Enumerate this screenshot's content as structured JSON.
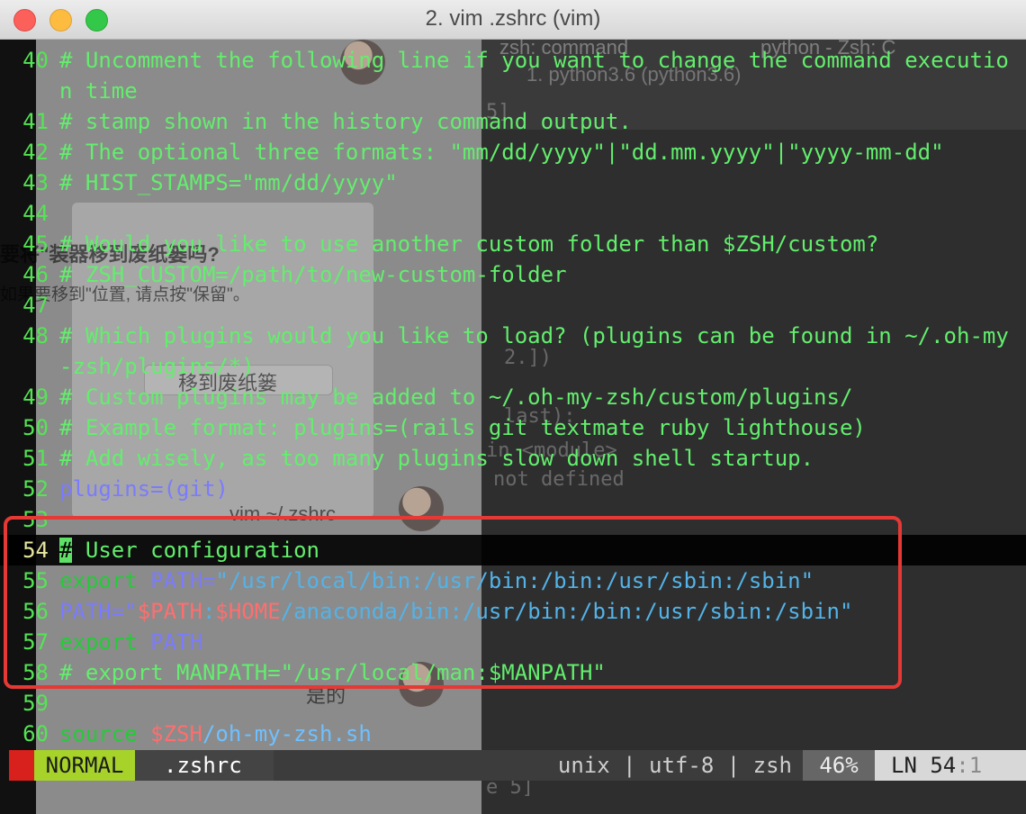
{
  "window": {
    "title": "2. vim .zshrc (vim)"
  },
  "background": {
    "tab_zsh": "zsh: command",
    "tab_python": "python - Zsh: C",
    "subtitle": "1. python3.6 (python3.6)",
    "dialog_heading": "要将\"装器移到废纸篓吗?",
    "dialog_body": "如果要移到\"位置, 请点按\"保留\"。",
    "dialog_button": "移到废纸篓",
    "chat_vim": "vim ~/.zshrc",
    "chat_yes": "是的",
    "term_bracket": "5]",
    "term_line1": "2.])",
    "term_line2": "last):",
    "term_line3": "in <module>",
    "term_line4": "not defined",
    "term_line5": "e 5]"
  },
  "editor": {
    "lines": [
      {
        "n": "40",
        "text": "# Uncomment the following line if you want to change the command execution time"
      },
      {
        "n": "41",
        "text": "# stamp shown in the history command output."
      },
      {
        "n": "42",
        "text": "# The optional three formats: \"mm/dd/yyyy\"|\"dd.mm.yyyy\"|\"yyyy-mm-dd\""
      },
      {
        "n": "43",
        "text": "# HIST_STAMPS=\"mm/dd/yyyy\""
      },
      {
        "n": "44",
        "text": ""
      },
      {
        "n": "45",
        "text": "# Would you like to use another custom folder than $ZSH/custom?"
      },
      {
        "n": "46",
        "text": "# ZSH_CUSTOM=/path/to/new-custom-folder"
      },
      {
        "n": "47",
        "text": ""
      },
      {
        "n": "48",
        "text": "# Which plugins would you like to load? (plugins can be found in ~/.oh-my-zsh/plugins/*)"
      },
      {
        "n": "49",
        "text": "# Custom plugins may be added to ~/.oh-my-zsh/custom/plugins/"
      },
      {
        "n": "50",
        "text": "# Example format: plugins=(rails git textmate ruby lighthouse)"
      },
      {
        "n": "51",
        "text": "# Add wisely, as too many plugins slow down shell startup."
      },
      {
        "n": "52",
        "text": "plugins=(git)"
      },
      {
        "n": "53",
        "text": ""
      },
      {
        "n": "54",
        "text": "# User configuration"
      },
      {
        "n": "55a",
        "text": "export"
      },
      {
        "n": "55b",
        "text": "PATH="
      },
      {
        "n": "55c",
        "text": "\"/usr/local/bin:/usr/bin:/bin:/usr/sbin:/sbin\""
      },
      {
        "n": "56a",
        "text": "PATH=\""
      },
      {
        "n": "56b",
        "text": "$PATH"
      },
      {
        "n": "56c",
        "text": ":"
      },
      {
        "n": "56d",
        "text": "$HOME"
      },
      {
        "n": "56e",
        "text": "/anaconda/bin:/usr/bin:/bin:/usr/sbin:/sbin\""
      },
      {
        "n": "57a",
        "text": "export"
      },
      {
        "n": "57b",
        "text": "PATH"
      },
      {
        "n": "58",
        "text": "# export MANPATH=\"/usr/local/man:$MANPATH\""
      },
      {
        "n": "59",
        "text": ""
      },
      {
        "n": "60a",
        "text": "source"
      },
      {
        "n": "60b",
        "text": "$ZSH"
      },
      {
        "n": "60c",
        "text": "/oh-my-zsh.sh"
      }
    ],
    "line_numbers": [
      "40",
      "41",
      "42",
      "43",
      "44",
      "45",
      "46",
      "47",
      "48",
      "49",
      "50",
      "51",
      "52",
      "53",
      "54",
      "55",
      "56",
      "57",
      "58",
      "59",
      "60"
    ],
    "cursor_line": "54",
    "cursor_char": "#"
  },
  "statusline": {
    "mode": "NORMAL",
    "filename": ".zshrc",
    "fileformat": "unix | utf-8 | zsh",
    "percent": "46%",
    "ln_label": "LN",
    "line": "54",
    "col": ":1"
  },
  "colors": {
    "comment": "#63ee6d",
    "keyword": "#27c93a",
    "variable": "#7b7bff",
    "string": "#53b3e8",
    "special": "#ff6e6e",
    "annotation_box": "#e53935",
    "mode_bg": "#a6d22a"
  }
}
